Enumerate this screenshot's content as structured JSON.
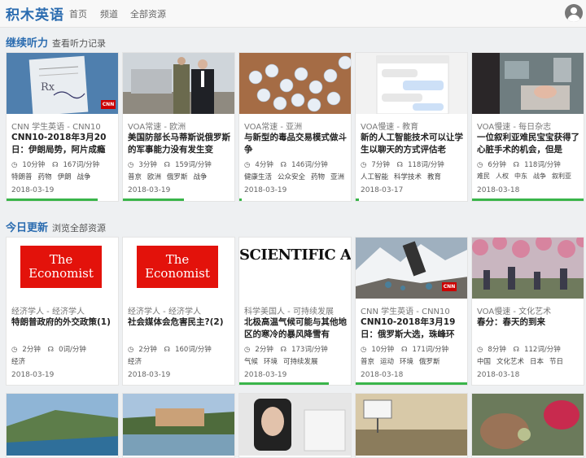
{
  "header": {
    "brand": "积木英语",
    "nav": [
      "首页",
      "频道",
      "全部资源"
    ]
  },
  "sections": {
    "continue": {
      "title": "继续听力",
      "link": "查看听力记录"
    },
    "today": {
      "title": "今日更新",
      "link": "浏览全部资源"
    }
  },
  "icons": {
    "duration": "clock-icon",
    "speed": "headphones-icon",
    "user": "user-avatar-icon"
  },
  "colors": {
    "brand": "#2b6cb0",
    "progress": "#39b54a",
    "economist_red": "#e3120b",
    "cnn_red": "#cc0000"
  },
  "continue_cards": [
    {
      "category": "CNN 学生英语 - CNN10",
      "title": "CNN10-2018年3月20日：伊朗局势，阿片成瘾",
      "duration": "10分钟",
      "speed": "167词/分钟",
      "tags": [
        "特朗普",
        "药物",
        "伊朗",
        "战争"
      ],
      "date": "2018-03-19",
      "progress": 0.82
    },
    {
      "category": "VOA常速 - 欧洲",
      "title": "美国防部长马蒂斯说俄罗斯的军事能力没有发生变",
      "duration": "3分钟",
      "speed": "159词/分钟",
      "tags": [
        "普京",
        "欧洲",
        "俄罗斯",
        "战争"
      ],
      "date": "2018-03-19",
      "progress": 0.55
    },
    {
      "category": "VOA常速 - 亚洲",
      "title": "与新型的毒品交易模式做斗争",
      "duration": "4分钟",
      "speed": "146词/分钟",
      "tags": [
        "健康生活",
        "公众安全",
        "药物",
        "亚洲"
      ],
      "date": "2018-03-19",
      "progress": 0.02
    },
    {
      "category": "VOA慢速 - 教育",
      "title": "新的人工智能技术可以让学生以聊天的方式评估老",
      "duration": "7分钟",
      "speed": "118词/分钟",
      "tags": [
        "人工智能",
        "科学技术",
        "教育"
      ],
      "date": "2018-03-17",
      "progress": 0.03
    },
    {
      "category": "VOA慢速 - 每日杂志",
      "title": "一位叙利亚难民宝宝获得了心脏手术的机会，但是",
      "duration": "6分钟",
      "speed": "118词/分钟",
      "tags": [
        "难民",
        "人权",
        "中东",
        "战争",
        "叙利亚"
      ],
      "date": "2018-03-18",
      "progress": 1.0
    }
  ],
  "today_cards": [
    {
      "category": "经济学人 - 经济学人",
      "title": "特朗普政府的外交政策(1)",
      "duration": "2分钟",
      "speed": "0词/分钟",
      "tags": [
        "经济"
      ],
      "date": "2018-03-19",
      "progress": 0.0,
      "thumb_text": "The Economist"
    },
    {
      "category": "经济学人 - 经济学人",
      "title": "社会媒体会危害民主?(2)",
      "duration": "2分钟",
      "speed": "160词/分钟",
      "tags": [
        "经济"
      ],
      "date": "2018-03-19",
      "progress": 0.0,
      "thumb_text": "The Economist"
    },
    {
      "category": "科学美国人 - 可持续发展",
      "title": "北极高温气候可能与其他地区的寒冷的暴风降雪有",
      "duration": "2分钟",
      "speed": "173词/分钟",
      "tags": [
        "气候",
        "环境",
        "可持续发展"
      ],
      "date": "2018-03-19",
      "progress": 0.8,
      "thumb_text": "SCIENTIFIC AMERICAN"
    },
    {
      "category": "CNN 学生英语 - CNN10",
      "title": "CNN10-2018年3月19日：俄罗斯大选，珠峰环",
      "duration": "10分钟",
      "speed": "171词/分钟",
      "tags": [
        "普京",
        "运动",
        "环境",
        "俄罗斯"
      ],
      "date": "2018-03-18",
      "progress": 1.0
    },
    {
      "category": "VOA慢速 - 文化艺术",
      "title": "春分：春天的到来",
      "duration": "8分钟",
      "speed": "112词/分钟",
      "tags": [
        "中国",
        "文化艺术",
        "日本",
        "节日"
      ],
      "date": "2018-03-18",
      "progress": 0.0
    }
  ]
}
